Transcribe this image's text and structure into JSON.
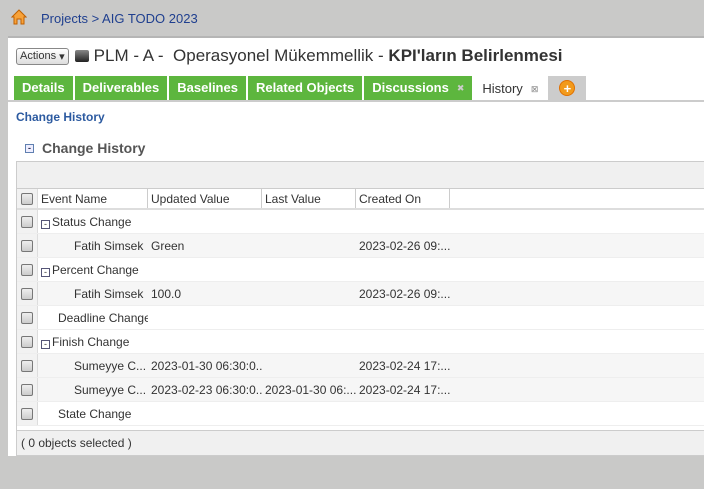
{
  "breadcrumb": "Projects > AIG TODO 2023",
  "title": {
    "actions": "Actions",
    "prefix": "PLM - A -  Operasyonel Mükemmellik - ",
    "bold": "KPI'ların Belirlenmesi"
  },
  "tabs": [
    {
      "label": "Details"
    },
    {
      "label": "Deliverables"
    },
    {
      "label": "Baselines"
    },
    {
      "label": "Related Objects"
    },
    {
      "label": "Discussions"
    },
    {
      "label": "History"
    }
  ],
  "sub_label": "Change History",
  "section_title": "Change History",
  "columns": [
    "Event Name",
    "Updated Value",
    "Last Value",
    "Created On"
  ],
  "rows": [
    {
      "event": "Status Change",
      "updated": "",
      "last": "",
      "created": ""
    },
    {
      "event": "Fatih Simsek",
      "updated": "Green",
      "last": "",
      "created": "2023-02-26 09:..."
    },
    {
      "event": "Percent Change",
      "updated": "",
      "last": "",
      "created": ""
    },
    {
      "event": "Fatih Simsek",
      "updated": "100.0",
      "last": "",
      "created": "2023-02-26 09:..."
    },
    {
      "event": "Deadline Change",
      "updated": "",
      "last": "",
      "created": ""
    },
    {
      "event": "Finish Change",
      "updated": "",
      "last": "",
      "created": ""
    },
    {
      "event": "Sumeyye C...",
      "updated": "2023-01-30 06:30:0...",
      "last": "",
      "created": "2023-02-24 17:..."
    },
    {
      "event": "Sumeyye C...",
      "updated": "2023-02-23 06:30:0...",
      "last": "2023-01-30 06:...",
      "created": "2023-02-24 17:..."
    },
    {
      "event": "State Change",
      "updated": "",
      "last": "",
      "created": ""
    }
  ],
  "footer": "( 0 objects selected )",
  "colors": {
    "tab_green": "#5db63e",
    "link_blue": "#1f3f8f"
  }
}
